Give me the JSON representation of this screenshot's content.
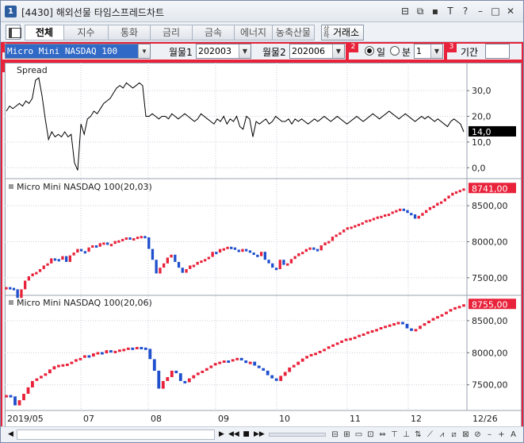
{
  "window": {
    "badge": "1",
    "title": "[4430] 해외선물 타임스프레드차트",
    "controls": [
      "⊟",
      "⧉",
      "▪",
      "T",
      "?",
      "–",
      "□",
      "✕"
    ]
  },
  "tabs": [
    "전체",
    "지수",
    "통화",
    "금리",
    "금속",
    "에너지",
    "농축산물"
  ],
  "exchange_button": {
    "mini": "상하",
    "label": "거래소"
  },
  "controls": {
    "badges": [
      "1",
      "2",
      "3",
      "4"
    ],
    "product": "Micro Mini NASDAQ 100",
    "month1_label": "월물1",
    "month1_value": "202003",
    "month2_label": "월물2",
    "month2_value": "202006",
    "day_label": "일",
    "minute_label": "분",
    "minute_value": "1",
    "period_label": "기간"
  },
  "chart_data": [
    {
      "type": "line",
      "title": "Spread",
      "yticks": [
        "30,0",
        "20,0",
        "10,0",
        "0,0"
      ],
      "current_label": "14,0",
      "ylim": [
        -3,
        39
      ],
      "color": "#000000",
      "values": [
        22,
        24,
        23,
        24,
        25,
        24,
        26,
        25,
        27,
        34,
        35,
        28,
        19,
        11,
        14,
        12,
        13,
        12,
        14,
        12,
        13,
        2,
        -1,
        17,
        13,
        19,
        20,
        22,
        21,
        23,
        25,
        26,
        27,
        29,
        31,
        32,
        31,
        33,
        32,
        31,
        32,
        33,
        32,
        20,
        20,
        21,
        20,
        19,
        20,
        20,
        19,
        21,
        20,
        19,
        20,
        21,
        20,
        19,
        18,
        19,
        21,
        20,
        19,
        18,
        17,
        19,
        18,
        20,
        17,
        19,
        18,
        20,
        16,
        15,
        20,
        19,
        12,
        18,
        17,
        18,
        19,
        17,
        18,
        20,
        19,
        18,
        18,
        19,
        17,
        19,
        18,
        19,
        18,
        17,
        18,
        19,
        18,
        19,
        20,
        19,
        18,
        19,
        20,
        19,
        18,
        17,
        18,
        19,
        20,
        19,
        18,
        19,
        20,
        21,
        20,
        19,
        20,
        21,
        22,
        21,
        20,
        19,
        20,
        21,
        20,
        19,
        18,
        19,
        20,
        19,
        20,
        19,
        18,
        19,
        18,
        17,
        16,
        18,
        19,
        18,
        17,
        14
      ]
    },
    {
      "type": "bar",
      "title": "Micro Mini NASDAQ 100(20,03)",
      "yticks": [
        "8500,00",
        "8000,00",
        "7500,00"
      ],
      "current_label": "8741,00",
      "ylim": [
        7300,
        8810
      ],
      "up_color": "#e8223a",
      "down_color": "#1f4fcc",
      "values": [
        7370,
        7360,
        7340,
        7220,
        7340,
        7460,
        7520,
        7560,
        7580,
        7620,
        7670,
        7700,
        7770,
        7760,
        7750,
        7800,
        7720,
        7810,
        7850,
        7900,
        7870,
        7860,
        7920,
        7950,
        7930,
        7980,
        7990,
        7960,
        7970,
        8010,
        8020,
        8040,
        8060,
        8030,
        8050,
        8070,
        8080,
        8060,
        7900,
        7750,
        7560,
        7640,
        7700,
        7780,
        7820,
        7720,
        7640,
        7570,
        7620,
        7670,
        7680,
        7720,
        7740,
        7760,
        7790,
        7860,
        7850,
        7900,
        7910,
        7930,
        7920,
        7890,
        7860,
        7900,
        7880,
        7850,
        7820,
        7800,
        7860,
        7750,
        7700,
        7640,
        7620,
        7750,
        7680,
        7700,
        7760,
        7800,
        7840,
        7860,
        7900,
        7920,
        7900,
        7880,
        7950,
        7990,
        8010,
        8070,
        8100,
        8130,
        8170,
        8200,
        8210,
        8230,
        8250,
        8270,
        8300,
        8310,
        8330,
        8350,
        8360,
        8380,
        8390,
        8420,
        8440,
        8460,
        8440,
        8400,
        8380,
        8320,
        8360,
        8400,
        8440,
        8480,
        8500,
        8540,
        8560,
        8600,
        8640,
        8680,
        8700,
        8720,
        8741
      ]
    },
    {
      "type": "bar",
      "title": "Micro Mini NASDAQ 100(20,06)",
      "yticks": [
        "8500,00",
        "8000,00",
        "7500,00"
      ],
      "current_label": "8755,00",
      "ylim": [
        7150,
        8820
      ],
      "up_color": "#e8223a",
      "down_color": "#1f4fcc",
      "values": [
        7340,
        7320,
        7180,
        7260,
        7360,
        7460,
        7560,
        7600,
        7640,
        7680,
        7740,
        7790,
        7810,
        7820,
        7830,
        7860,
        7900,
        7920,
        7960,
        7940,
        7990,
        8010,
        7990,
        8040,
        8020,
        8030,
        8050,
        8060,
        8080,
        8070,
        8090,
        8080,
        8060,
        7900,
        7720,
        7440,
        7560,
        7620,
        7720,
        7680,
        7560,
        7540,
        7600,
        7650,
        7690,
        7720,
        7760,
        7800,
        7840,
        7860,
        7880,
        7870,
        7900,
        7920,
        7880,
        7840,
        7860,
        7800,
        7760,
        7720,
        7650,
        7600,
        7560,
        7640,
        7700,
        7770,
        7810,
        7860,
        7910,
        7950,
        7980,
        8000,
        8030,
        8060,
        8100,
        8130,
        8160,
        8190,
        8220,
        8230,
        8250,
        8280,
        8300,
        8330,
        8350,
        8370,
        8400,
        8420,
        8440,
        8460,
        8480,
        8450,
        8380,
        8340,
        8370,
        8420,
        8460,
        8500,
        8540,
        8570,
        8600,
        8640,
        8680,
        8710,
        8730,
        8755
      ]
    }
  ],
  "x_axis": {
    "labels": [
      "2019/05",
      "07",
      "08",
      "09",
      "10",
      "11",
      "12",
      "12/26"
    ]
  },
  "scrollbar": {
    "buttons": [
      "◀",
      "▶",
      "◀◀",
      "■",
      "▶▶"
    ],
    "tools": [
      "⊟",
      "⊞",
      "▭",
      "⊡",
      "⇔",
      "⊤",
      "⊥",
      "⇅",
      "⟋",
      "⩘",
      "⧄",
      "⊠",
      "⊘",
      "–",
      "+",
      "A"
    ]
  }
}
